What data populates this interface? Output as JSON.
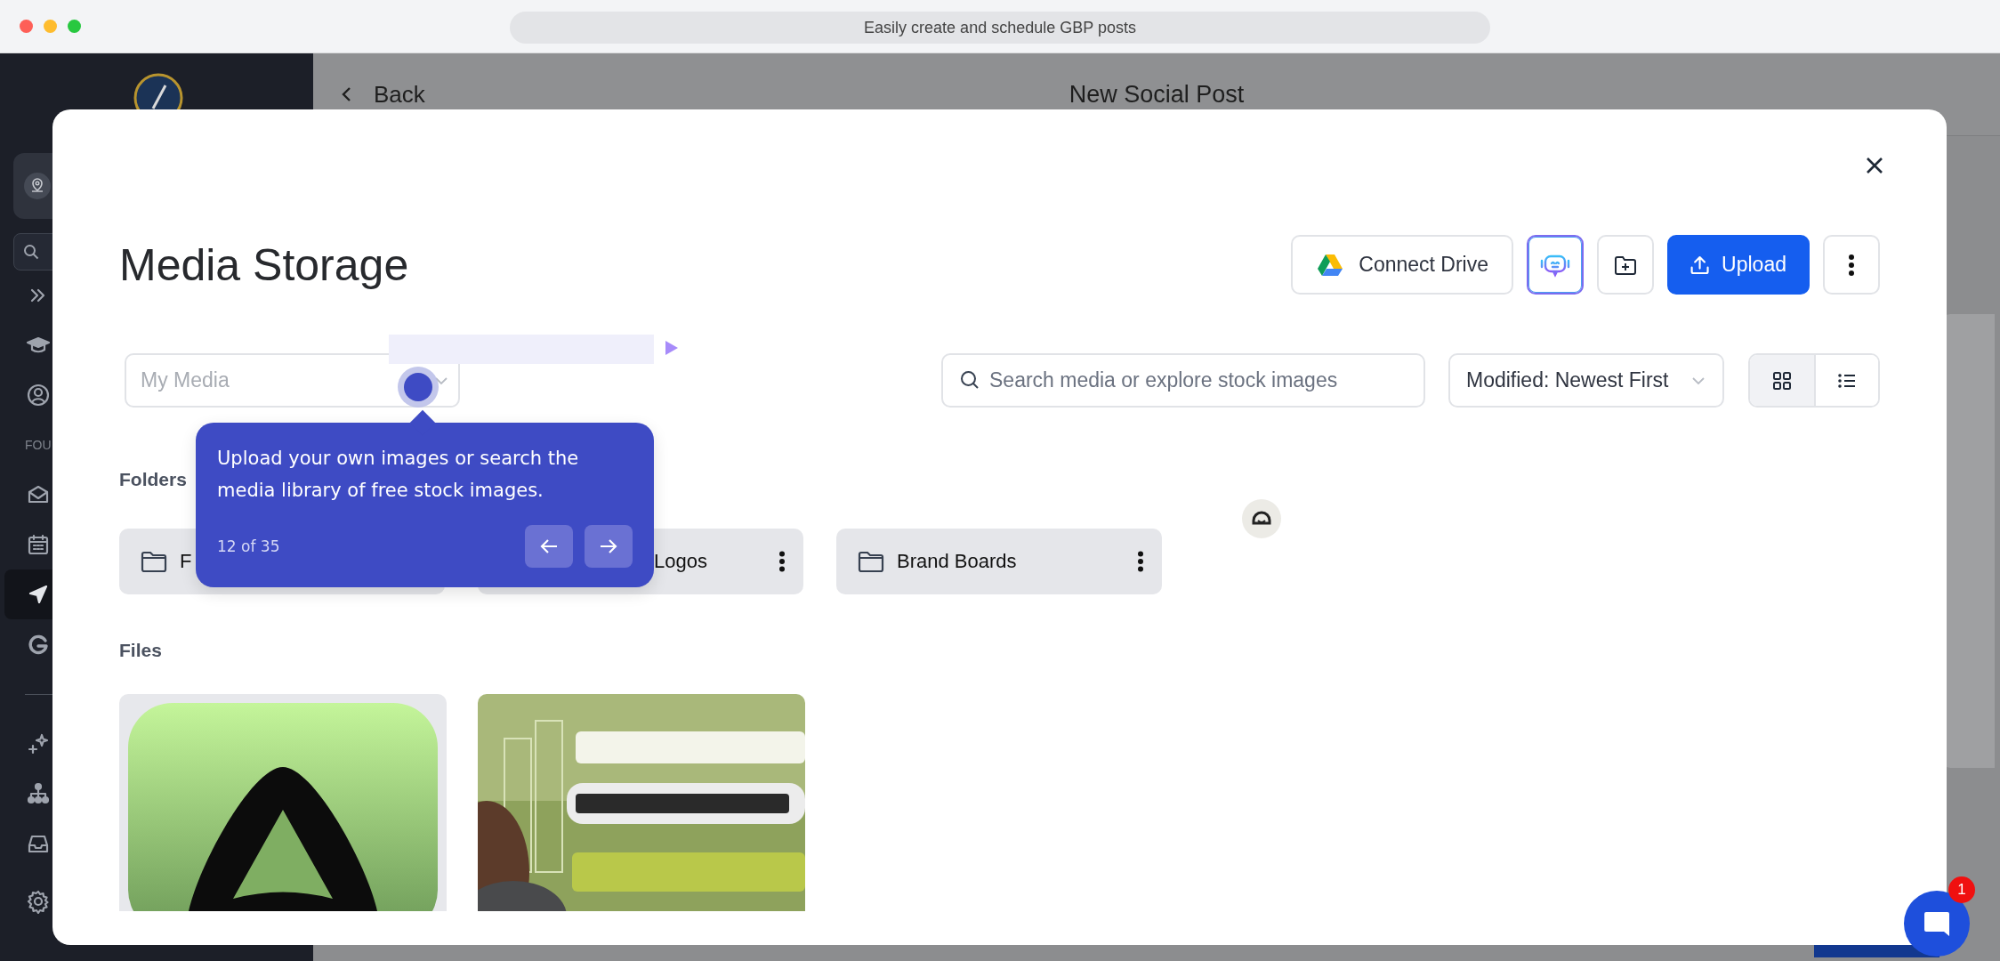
{
  "browser": {
    "address": "Easily create and schedule GBP posts"
  },
  "sidebar": {
    "section_label": "FOU",
    "top_items": [
      {
        "kind": "expand",
        "selected": false
      },
      {
        "kind": "learn",
        "selected": false
      },
      {
        "kind": "account",
        "selected": false
      }
    ],
    "mid_items": [
      {
        "kind": "mail",
        "selected": false
      },
      {
        "kind": "calendar",
        "selected": false
      },
      {
        "kind": "send",
        "selected": true
      },
      {
        "kind": "google",
        "selected": false
      }
    ],
    "bottom_items": [
      {
        "kind": "ai",
        "selected": false
      },
      {
        "kind": "hierarchy",
        "selected": false
      },
      {
        "kind": "inbox",
        "selected": false
      },
      {
        "kind": "settings",
        "selected": false
      }
    ]
  },
  "header": {
    "back": "Back",
    "title": "New Social Post"
  },
  "modal": {
    "title": "Media Storage",
    "connect_drive": "Connect Drive",
    "upload": "Upload",
    "folder_select": {
      "placeholder": "My Media"
    },
    "search": {
      "placeholder": "Search media or explore stock images"
    },
    "sort": "Modified: Newest First",
    "views": [
      {
        "kind": "grid",
        "selected": true
      },
      {
        "kind": "list",
        "selected": false
      }
    ],
    "folders_label": "Folders",
    "folders": [
      {
        "name": "F",
        "icon_covered": false
      },
      {
        "name": "Logos",
        "icon_covered": true
      },
      {
        "name": "Brand Boards",
        "icon_covered": false
      }
    ],
    "files_label": "Files"
  },
  "tour": {
    "text": "Upload your own images or search the media library of free stock images.",
    "step": "12 of 35"
  },
  "chat": {
    "badge": "1"
  }
}
